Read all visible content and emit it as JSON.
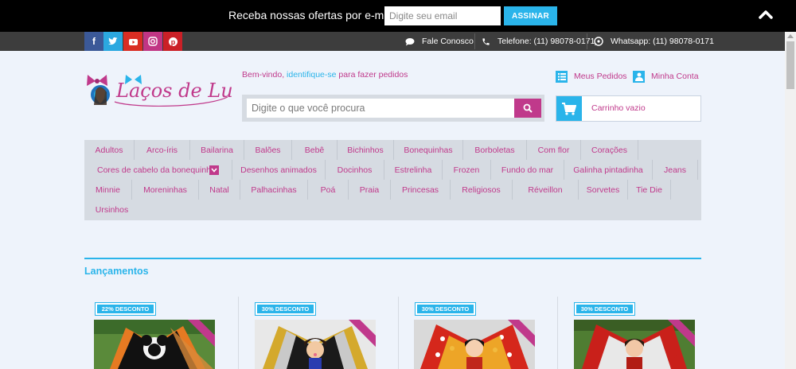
{
  "newsletter": {
    "label": "Receba nossas ofertas por e-mail",
    "email_placeholder": "Digite seu email",
    "button": "ASSINAR"
  },
  "contact_bar": {
    "social": [
      "facebook",
      "twitter",
      "youtube",
      "instagram",
      "pinterest"
    ],
    "fale": "Fale Conosco",
    "telefone": "Telefone: (11) 98078-0171",
    "whatsapp": "Whatsapp: (11) 98078-0171"
  },
  "header": {
    "welcome_prefix": "Bem-vindo, ",
    "welcome_link": "identifique-se",
    "welcome_suffix": " para fazer pedidos",
    "search_placeholder": "Digite o que você procura",
    "meus_pedidos": "Meus Pedidos",
    "minha_conta": "Minha Conta",
    "cart": "Carrinho vazio"
  },
  "categories": [
    "Adultos",
    "Arco-íris",
    "Bailarina",
    "Balões",
    "Bebê",
    "Bichinhos",
    "Bonequinhas",
    "Borboletas",
    "Com flor",
    "Corações",
    "Cores de cabelo da bonequinha",
    "Desenhos animados",
    "Docinhos",
    "Estrelinha",
    "Frozen",
    "Fundo do mar",
    "Galinha pintadinha",
    "Jeans",
    "Minnie",
    "Moreninhas",
    "Natal",
    "Palhacinhas",
    "Poá",
    "Praia",
    "Princesas",
    "Religiosos",
    "Réveillon",
    "Sorvetes",
    "Tie Die",
    "Ursinhos"
  ],
  "section": {
    "title": "Lançamentos"
  },
  "products": [
    {
      "discount": "22% DESCONTO"
    },
    {
      "discount": "30% DESCONTO"
    },
    {
      "discount": "30% DESCONTO"
    },
    {
      "discount": "30% DESCONTO"
    }
  ],
  "colors": {
    "accent_blue": "#2ab4ea",
    "accent_pink": "#c0398b",
    "topbar": "#000000",
    "contactbar": "#3d3d3d",
    "page_bg": "#eef3fb"
  }
}
